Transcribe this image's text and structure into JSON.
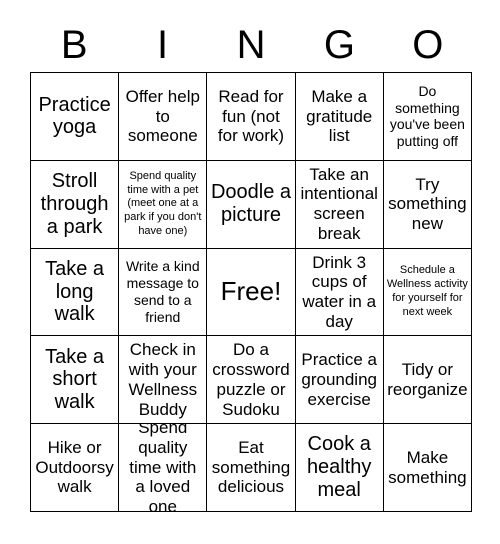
{
  "card": {
    "header_letters": [
      "B",
      "I",
      "N",
      "G",
      "O"
    ],
    "columns": 5,
    "rows": 5,
    "border_color": "#000000",
    "background_color": "#ffffff",
    "text_color": "#000000",
    "cells": [
      {
        "text": "Practice yoga",
        "size": "lg"
      },
      {
        "text": "Offer help to someone",
        "size": "md"
      },
      {
        "text": "Read for fun (not for work)",
        "size": "md"
      },
      {
        "text": "Make a gratitude list",
        "size": "md"
      },
      {
        "text": "Do something you've been putting off",
        "size": "sm"
      },
      {
        "text": "Stroll through a park",
        "size": "lg"
      },
      {
        "text": "Spend quality time with a pet (meet one at a park if you don't have one)",
        "size": "xs"
      },
      {
        "text": "Doodle a picture",
        "size": "lg"
      },
      {
        "text": "Take an intentional screen break",
        "size": "md"
      },
      {
        "text": "Try something new",
        "size": "md"
      },
      {
        "text": "Take a long walk",
        "size": "lg"
      },
      {
        "text": "Write a kind message to send to a friend",
        "size": "sm"
      },
      {
        "text": "Free!",
        "size": "xl"
      },
      {
        "text": "Drink 3 cups of water in a day",
        "size": "md"
      },
      {
        "text": "Schedule a Wellness activity for yourself for next week",
        "size": "xs"
      },
      {
        "text": "Take a short walk",
        "size": "lg"
      },
      {
        "text": "Check in with your Wellness Buddy",
        "size": "md"
      },
      {
        "text": "Do a crossword puzzle or Sudoku",
        "size": "md"
      },
      {
        "text": "Practice a grounding exercise",
        "size": "md"
      },
      {
        "text": "Tidy or reorganize",
        "size": "md"
      },
      {
        "text": "Hike or Outdoorsy walk",
        "size": "md"
      },
      {
        "text": "Spend quality time with a loved one",
        "size": "md"
      },
      {
        "text": "Eat something delicious",
        "size": "md"
      },
      {
        "text": "Cook a healthy meal",
        "size": "lg"
      },
      {
        "text": "Make something",
        "size": "md"
      }
    ]
  }
}
